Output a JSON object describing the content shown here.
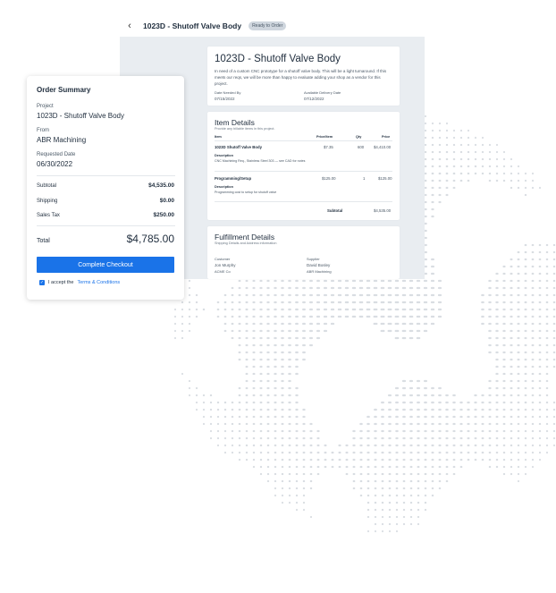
{
  "header": {
    "back_icon": "chevron-left-icon",
    "title": "1023D - Shutoff Valve Body",
    "badge": "Ready to Order"
  },
  "project_card": {
    "title": "1023D - Shutoff Valve Body",
    "description": "In need of a custom CNC prototype for a shutoff valve body. This will be a light turnaround. If this meets our reqs, we will be more than happy to evaluate adding your shop as a vendor for this project.",
    "date_needed_label": "Date Needed By",
    "date_needed": "07/15/2022",
    "delivery_label": "Available Delivery Date",
    "delivery": "07/12/2022"
  },
  "items_card": {
    "title": "Item Details",
    "subtitle": "Provide any billable items in this project.",
    "columns": {
      "item": "Item",
      "price_item": "Price/Item",
      "qty": "Qty",
      "price": "Price"
    },
    "rows": [
      {
        "name": "1023D Shutoff Valve Body",
        "price_item": "$7.35",
        "qty": "600",
        "price": "$4,410.00",
        "desc_label": "Description",
        "desc": "CNC Machining Req., Stainless Steel 303 — see CAD for notes"
      },
      {
        "name": "Programming/Setup",
        "price_item": "$125.00",
        "qty": "1",
        "price": "$125.00",
        "desc_label": "Description",
        "desc": "Programming cost to setup for shutoff valve"
      }
    ],
    "subtotal_label": "Subtotal",
    "subtotal": "$4,535.00"
  },
  "fulfillment_card": {
    "title": "Fulfillment Details",
    "subtitle": "Shipping Details and Address information",
    "customer_label": "Customer",
    "customer_name": "Jon Murphy",
    "customer_company": "ACME Co",
    "supplier_label": "Supplier",
    "supplier_name": "David Bosley",
    "supplier_company": "ABR Machining"
  },
  "summary": {
    "title": "Order Summary",
    "project_label": "Project",
    "project": "1023D - Shutoff Valve Body",
    "from_label": "From",
    "from": "ABR Machining",
    "requested_label": "Requested Date",
    "requested": "06/30/2022",
    "subtotal_label": "Subtotal",
    "subtotal": "$4,535.00",
    "shipping_label": "Shipping",
    "shipping": "$0.00",
    "tax_label": "Sales Tax",
    "tax": "$250.00",
    "total_label": "Total",
    "total": "$4,785.00",
    "checkout_label": "Complete Checkout",
    "terms_prefix": "I accept the",
    "terms_link": "Terms & Conditions",
    "checkbox_checked": true
  },
  "colors": {
    "accent": "#1a73e8",
    "panel_bg": "#e9edf1",
    "dots": "#d9dde2"
  }
}
